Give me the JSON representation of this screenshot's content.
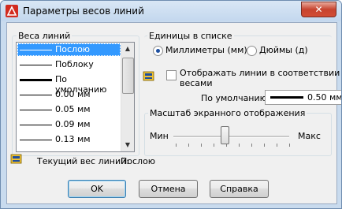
{
  "window": {
    "title": "Параметры весов линий",
    "close_glyph": "✕"
  },
  "weights": {
    "legend": "Веса линий",
    "items": [
      {
        "label": "Послою",
        "selected": true
      },
      {
        "label": "Поблоку",
        "selected": false
      },
      {
        "label": "По умолчанию",
        "selected": false
      },
      {
        "label": "0.00 мм",
        "selected": false
      },
      {
        "label": "0.05 мм",
        "selected": false
      },
      {
        "label": "0.09 мм",
        "selected": false
      },
      {
        "label": "0.13 мм",
        "selected": false
      }
    ]
  },
  "units": {
    "legend": "Единицы в списке",
    "millimeters": "Миллиметры (мм)",
    "inches": "Дюймы (д)",
    "selected": "millimeters"
  },
  "display": {
    "checkbox_label_line1": "Отображать линии в соответствии с",
    "checkbox_label_line2": "весами",
    "checked": false,
    "default_label": "По умолчанию",
    "default_value": "0.50 мм"
  },
  "scale": {
    "legend": "Масштаб экранного отображения",
    "min_label": "Мин",
    "max_label": "Макс",
    "level": 0.44
  },
  "current": {
    "label": "Текущий вес линий:",
    "value": "Послою"
  },
  "buttons": {
    "ok": "OK",
    "cancel": "Отмена",
    "help": "Справка"
  },
  "colors": {
    "selection": "#3399ff",
    "close": "#c7432f"
  }
}
